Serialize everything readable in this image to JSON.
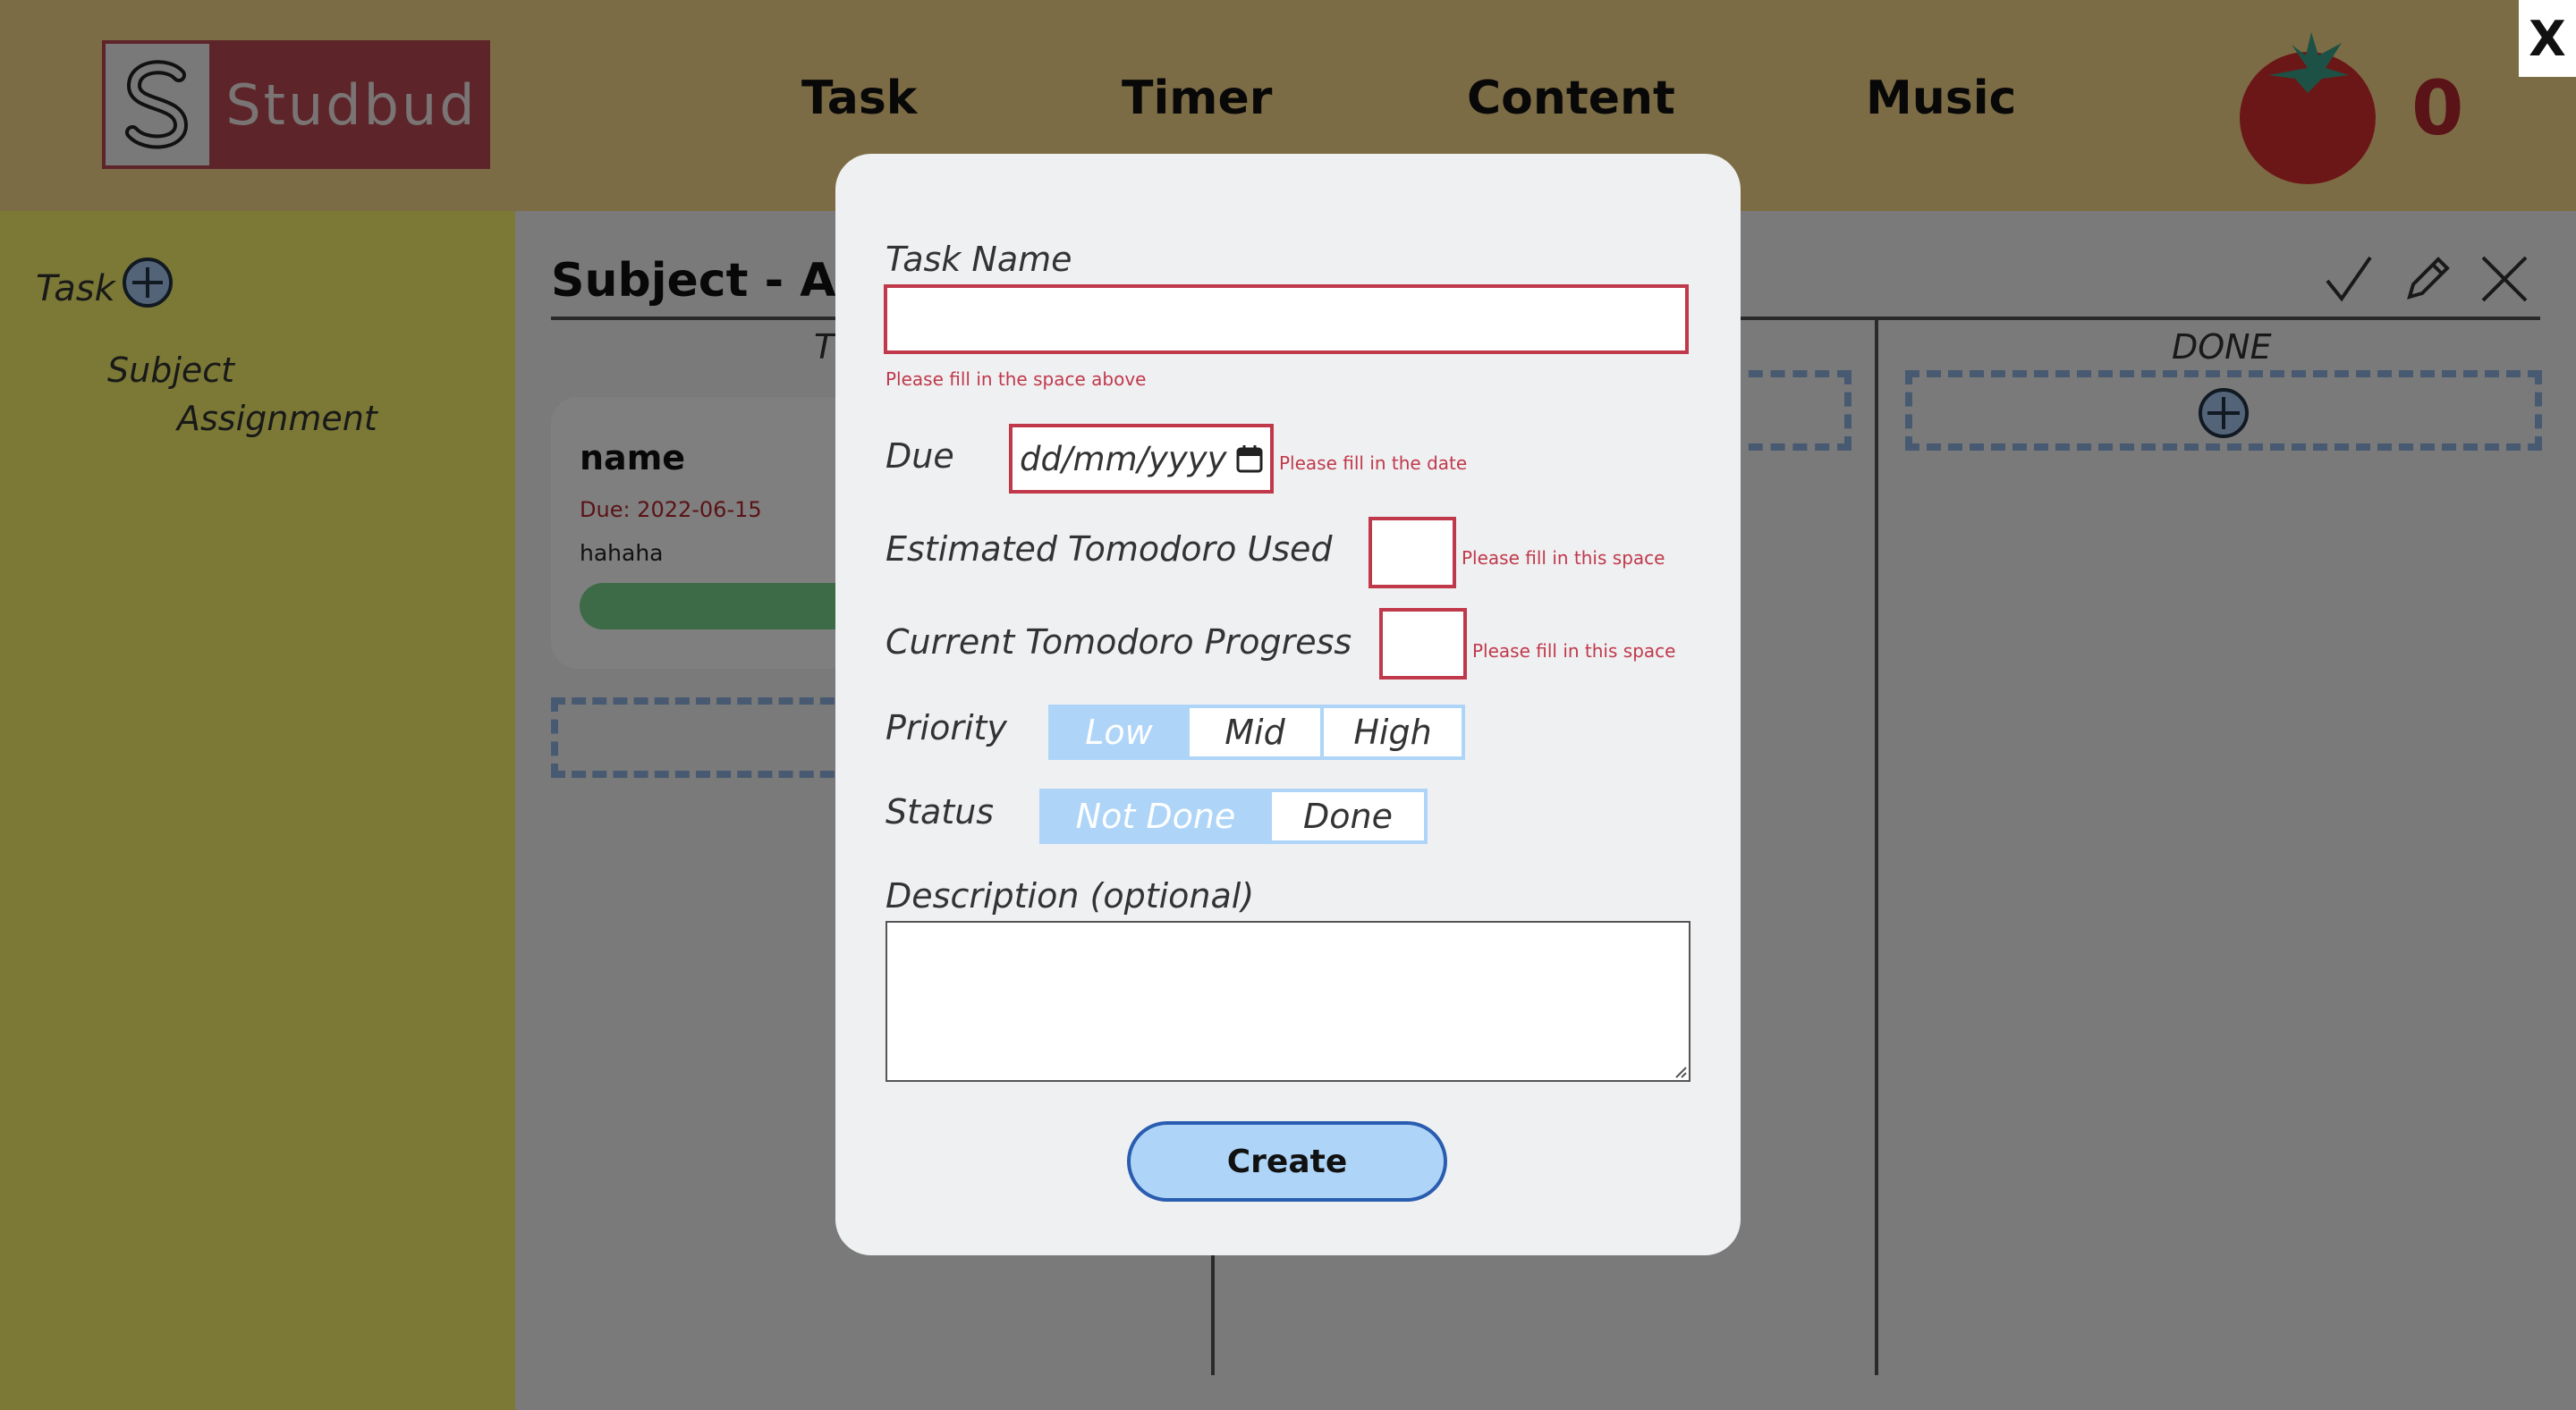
{
  "header": {
    "logo_text": "Studbud",
    "nav": [
      "Task",
      "Timer",
      "Content",
      "Music"
    ],
    "tomato_count": "0"
  },
  "sidebar": {
    "task_label": "Task",
    "subject": "Subject",
    "assignment": "Assignment"
  },
  "main": {
    "title": "Subject - Ass",
    "todo_label_partial": "T",
    "done_label": "DONE",
    "card": {
      "name": "name",
      "due": "Due: 2022-06-15",
      "description": "hahaha"
    }
  },
  "modal": {
    "task_name_label": "Task Name",
    "task_name_error": "Please fill in the space above",
    "due_label": "Due",
    "due_placeholder": "dd/mm/yyyy",
    "due_error": "Please fill in the date",
    "est_label": "Estimated Tomodoro Used",
    "est_error": "Please fill in this space",
    "cur_label": "Current Tomodoro Progress",
    "cur_error": "Please fill in this space",
    "priority_label": "Priority",
    "priority_options": [
      "Low",
      "Mid",
      "High"
    ],
    "priority_selected": "Low",
    "status_label": "Status",
    "status_options": [
      "Not Done",
      "Done"
    ],
    "status_selected": "Not Done",
    "description_label": "Description (optional)",
    "create_label": "Create"
  },
  "close_label": "X",
  "colors": {
    "header": "#f8d98a",
    "sidebar": "#f6f36a",
    "logo_red": "#ba4a52",
    "error_red": "#c0394b",
    "selected_blue": "#aed5f8",
    "button_border": "#2a5db0"
  }
}
